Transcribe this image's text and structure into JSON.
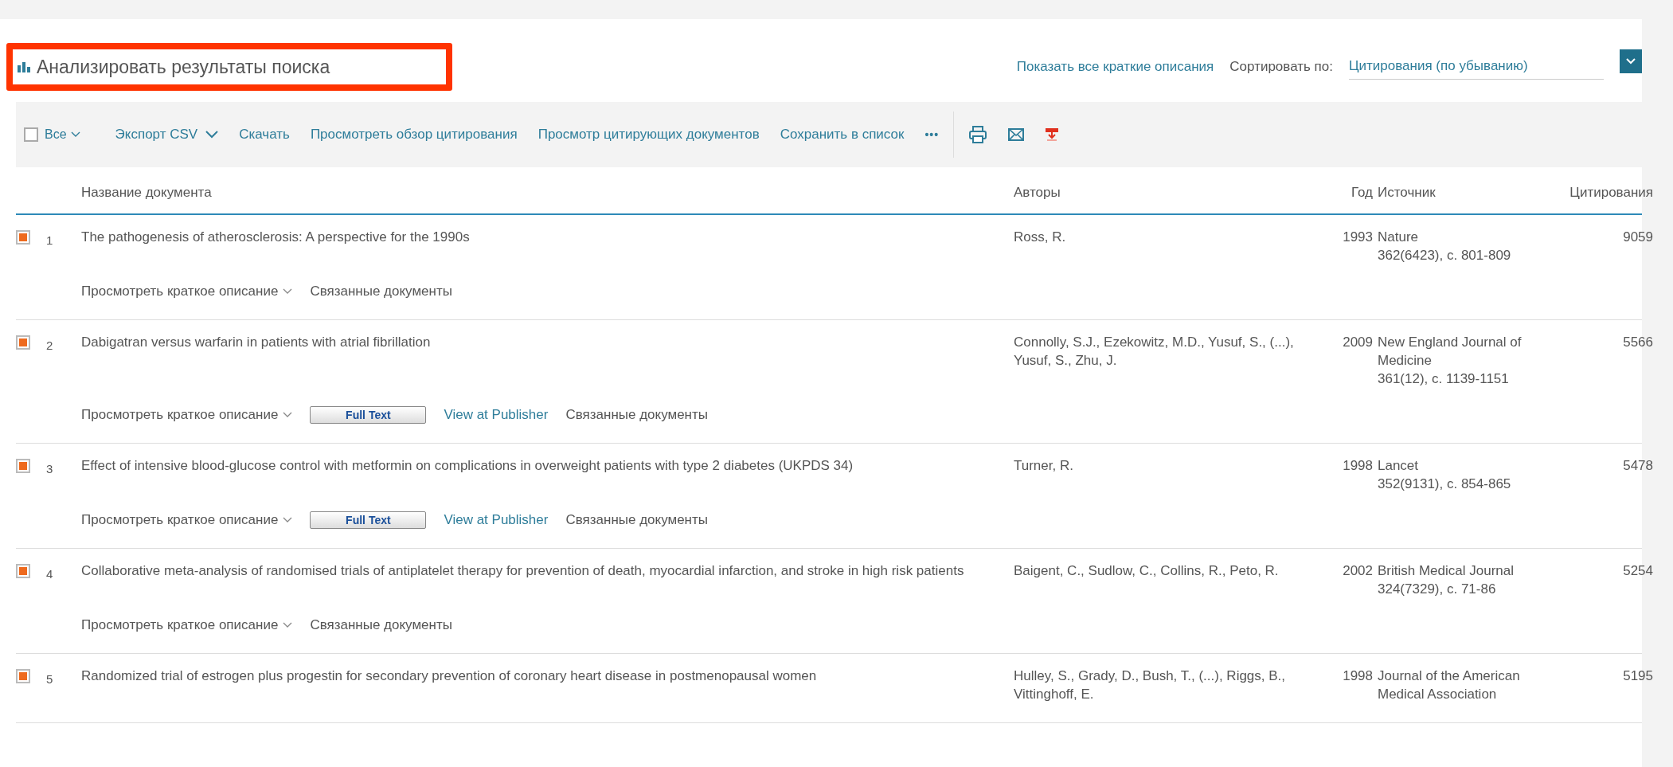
{
  "header": {
    "title": "Анализировать результаты поиска",
    "show_abstracts": "Показать все краткие описания",
    "sort_label": "Сортировать по:",
    "sort_value": "Цитирования (по убыванию)"
  },
  "toolbar": {
    "select_all": {
      "label": "Все",
      "checked": false
    },
    "items": [
      {
        "kind": "dropdown",
        "label": "Экспорт CSV"
      },
      {
        "kind": "link",
        "label": "Скачать"
      },
      {
        "kind": "link",
        "label": "Просмотреть обзор цитирования"
      },
      {
        "kind": "link",
        "label": "Просмотр цитирующих документов"
      },
      {
        "kind": "link",
        "label": "Сохранить в список"
      },
      {
        "kind": "more",
        "label": "•••"
      }
    ]
  },
  "table": {
    "columns": [
      "Название документа",
      "Авторы",
      "Год",
      "Источник",
      "Цитирования"
    ],
    "rows": [
      {
        "checked": true,
        "number": "1",
        "title": "The pathogenesis of atherosclerosis: A perspective for the 1990s",
        "authors": "Ross, R.",
        "year": "1993",
        "source": [
          "Nature",
          "362(6423), c. 801-809"
        ],
        "citations": "9059",
        "actions": [
          {
            "kind": "abstract",
            "label": "Просмотреть краткое описание"
          },
          {
            "kind": "link",
            "label": "Связанные документы"
          }
        ]
      },
      {
        "checked": true,
        "number": "2",
        "title": "Dabigatran versus warfarin in patients with atrial fibrillation",
        "authors": "Connolly, S.J., Ezekowitz, M.D., Yusuf, S., (...), Yusuf, S., Zhu, J.",
        "year": "2009",
        "source": [
          "New England Journal of Medicine",
          "361(12), c. 1139-1151"
        ],
        "citations": "5566",
        "actions": [
          {
            "kind": "abstract",
            "label": "Просмотреть краткое описание"
          },
          {
            "kind": "fulltext",
            "label": "Full Text"
          },
          {
            "kind": "link",
            "label": "View at Publisher"
          },
          {
            "kind": "link",
            "label": "Связанные документы"
          }
        ]
      },
      {
        "checked": true,
        "number": "3",
        "title": "Effect of intensive blood-glucose control with metformin on complications in overweight patients with type 2 diabetes (UKPDS 34)",
        "authors": "Turner, R.",
        "year": "1998",
        "source": [
          "Lancet",
          "352(9131), c. 854-865"
        ],
        "citations": "5478",
        "actions": [
          {
            "kind": "abstract",
            "label": "Просмотреть краткое описание"
          },
          {
            "kind": "fulltext",
            "label": "Full Text"
          },
          {
            "kind": "link",
            "label": "View at Publisher"
          },
          {
            "kind": "link",
            "label": "Связанные документы"
          }
        ]
      },
      {
        "checked": true,
        "number": "4",
        "title": "Collaborative meta-analysis of randomised trials of antiplatelet therapy for prevention of death, myocardial infarction, and stroke in high risk patients",
        "authors": "Baigent, C., Sudlow, C., Collins, R., Peto, R.",
        "year": "2002",
        "source": [
          "British Medical Journal",
          "324(7329), c. 71-86"
        ],
        "citations": "5254",
        "actions": [
          {
            "kind": "abstract",
            "label": "Просмотреть краткое описание"
          },
          {
            "kind": "link",
            "label": "Связанные документы"
          }
        ]
      },
      {
        "checked": true,
        "number": "5",
        "title": "Randomized trial of estrogen plus progestin for secondary prevention of coronary heart disease in postmenopausal women",
        "authors": "Hulley, S., Grady, D., Bush, T., (...), Riggs, B., Vittinghoff, E.",
        "year": "1998",
        "source": [
          "Journal of the American Medical Association"
        ],
        "citations": "5195",
        "actions": []
      }
    ]
  }
}
